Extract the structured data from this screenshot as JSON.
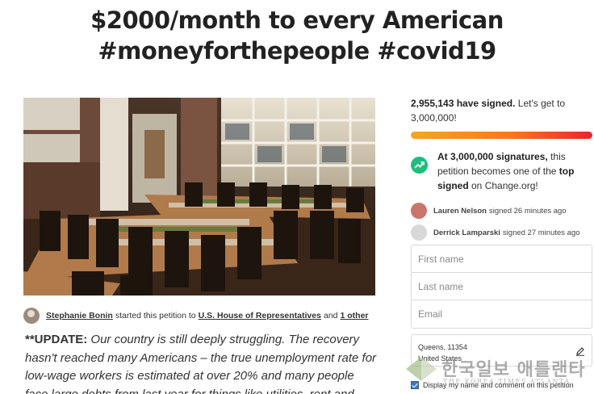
{
  "petition": {
    "title_line1": "$2000/month to every American",
    "title_line2": "#moneyforthepeople #covid19"
  },
  "starter": {
    "name": "Stephanie Bonin",
    "started_text": "started this petition to",
    "target": "U.S. House of Representatives",
    "and_text": "and",
    "other": "1 other"
  },
  "body": {
    "lead": "**UPDATE:",
    "text": " Our country is still deeply struggling. The recovery hasn't reached many Americans – the true unemployment rate for low-wage workers is estimated at over 20% and many people face large debts from last year for things like utilities, rent and"
  },
  "signatures": {
    "count": "2,955,143 have signed.",
    "goal_text": "Let's get to 3,000,000!",
    "progress_fraction": 0.985,
    "milestone_bold": "At 3,000,000 signatures,",
    "milestone_text": " this petition becomes one of the ",
    "milestone_bold2": "top signed",
    "milestone_text2": " on Change.org!"
  },
  "recent_signers": [
    {
      "name": "Lauren Nelson",
      "text": "signed 26 minutes ago"
    },
    {
      "name": "Derrick Lamparski",
      "text": "signed 27 minutes ago"
    }
  ],
  "form": {
    "first_name_placeholder": "First name",
    "last_name_placeholder": "Last name",
    "email_placeholder": "Email",
    "location_line1": "Queens, 11354",
    "location_line2": "United States",
    "display_checkbox_label": "Display my name and comment on this petition",
    "display_checked": true
  },
  "watermark": {
    "main": "한국일보 애틀랜타",
    "sub": "THE KOREA TIMES ATLANTA"
  },
  "colors": {
    "progress_start": "#f5a623",
    "progress_end": "#e8262a",
    "milestone_icon": "#1dbd7b",
    "checkbox": "#2a7de1"
  },
  "icons": {
    "milestone": "trending-up-icon",
    "edit": "pencil-icon"
  }
}
